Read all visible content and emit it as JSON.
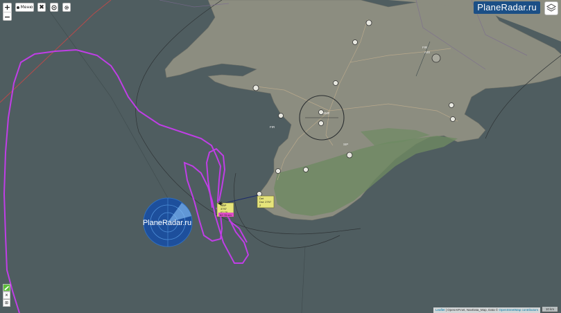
{
  "toolbar": {
    "menu_label": "Меню",
    "zoom_in": "+",
    "zoom_out": "−",
    "close_symbol": "✖"
  },
  "logo": {
    "text": "PlaneRadar.ru"
  },
  "watermark": {
    "text": "PlaneRadar.ru"
  },
  "selected_flight": {
    "label_lines": [
      "OBP",
      "3797",
      "62.78"
    ],
    "label_distance": "62.78 nm",
    "info_lines": [
      "Det",
      "Dst: 2797",
      "2"
    ]
  },
  "side_controls": {
    "close": "✕",
    "extra": "⊞"
  },
  "attribution": {
    "leaflet": "Leaflet",
    "text": " | OpenAIP.net, NavData_Map, Data © ",
    "osm": "OpenStreetMap contributors"
  },
  "scale": {
    "text": "10 km"
  },
  "colors": {
    "sea": "#4f5d60",
    "land": "#8e8f82",
    "track": "#c03ee6",
    "logo_bg": "#1b4f86",
    "label_bg": "#e6e47a"
  },
  "icons": [
    "zoom-in-icon",
    "zoom-out-icon",
    "menu-icon",
    "close-icon",
    "target-icon",
    "gear-icon",
    "layers-icon",
    "plane-icon",
    "radar-icon"
  ]
}
